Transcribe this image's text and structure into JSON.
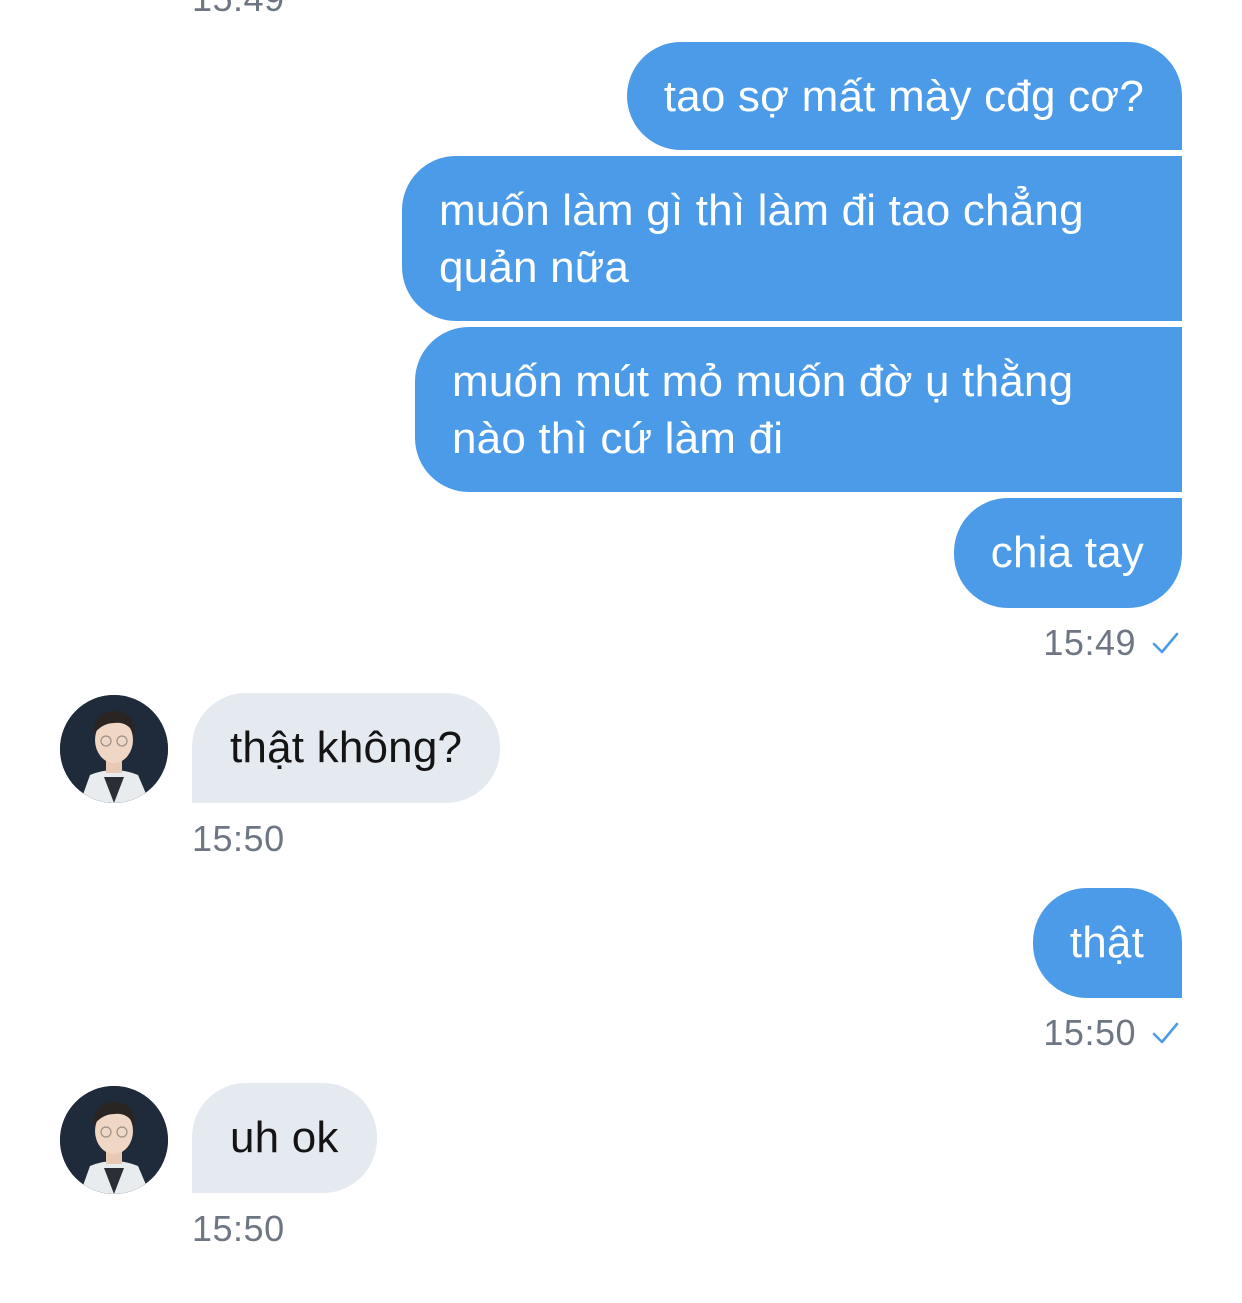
{
  "top_time_fragment": "15:49",
  "messages": {
    "m1": "tao sợ mất mày cđg cơ?",
    "m2": "muốn làm gì thì làm đi tao chẳng quản nữa",
    "m3": "muốn mút mỏ muốn đờ ụ thằng nào thì cứ làm đi",
    "m4": "chia tay",
    "t1": "15:49",
    "m5": "thật không?",
    "t2": "15:50",
    "m6": "thật",
    "t3": "15:50",
    "m7": "uh ok",
    "t4": "15:50"
  },
  "icons": {
    "read_receipt": "check-icon",
    "contact_avatar": "avatar"
  },
  "colors": {
    "outgoing_bubble": "#4c9be8",
    "incoming_bubble": "#e5e9f0",
    "timestamp": "#6d7682",
    "check": "#4c9be8"
  }
}
